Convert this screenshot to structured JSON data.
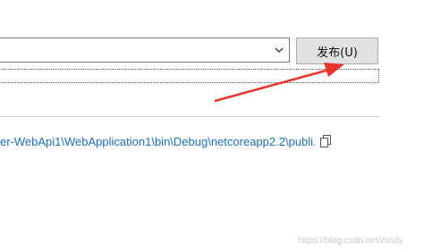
{
  "target": {
    "selected_value": "",
    "publish_label": "发布(U)"
  },
  "output": {
    "path": "er-WebApi1\\WebApplication1\\bin\\Debug\\netcoreapp2.2\\publi..."
  },
  "icons": {
    "dropdown": "chevron-down-icon",
    "copy": "copy-icon",
    "annotation": "red-arrow"
  },
  "watermark": "https://blog.csdn.net/essity",
  "colors": {
    "link": "#1a6fc4",
    "arrow": "#e8352b",
    "button_bg": "#e1e1e1"
  }
}
